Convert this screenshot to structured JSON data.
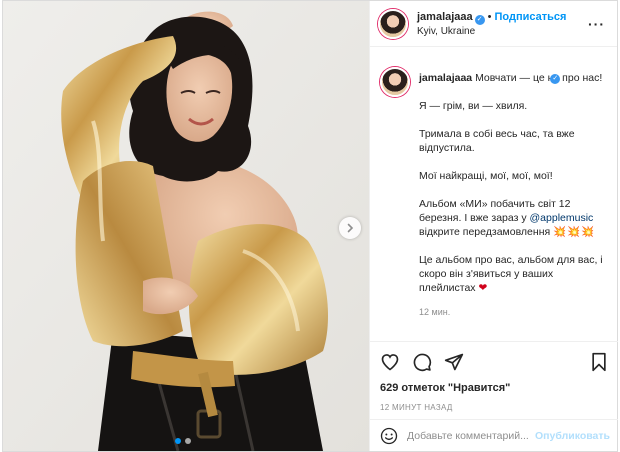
{
  "post": {
    "username": "jamalajaaa",
    "verified_mark": "✓",
    "separator": "•",
    "follow_label": "Подписаться",
    "location": "Kyiv, Ukraine",
    "more_glyph": "···",
    "carousel_count": 2,
    "carousel_active": 1
  },
  "caption": {
    "username": "jamalajaaa",
    "line1": "Мовчати — це не про нас!",
    "line2": "Я — грім, ви — хвиля.",
    "line3": "Тримала в собі весь час, та вже відпустила.",
    "line4": "Мої найкращі, мої, мої, мої!",
    "line5_part1": "Альбом «МИ» побачить світ 12 березня. І вже зараз у ",
    "line5_mention": "@applemusic",
    "line5_part2": " відкрите передзамовлення ",
    "line5_emoji": "💥💥💥",
    "line6": "Це альбом про вас, альбом для вас, і скоро він з'явиться у ваших плейлистах ",
    "line6_emoji": "❤",
    "time": "12 мин."
  },
  "actions": {
    "icons": [
      "heart-icon",
      "comment-icon",
      "share-icon",
      "bookmark-icon"
    ],
    "likes": "629 отметок \"Нравится\"",
    "timestamp": "12 минут назад"
  },
  "comment": {
    "placeholder": "Добавьте комментарий...",
    "publish_label": "Опубликовать"
  },
  "colors": {
    "accent": "#0095f6",
    "verified": "#3897f0",
    "jacket_gold": "#d8b46a",
    "background": "#ecebe8"
  }
}
